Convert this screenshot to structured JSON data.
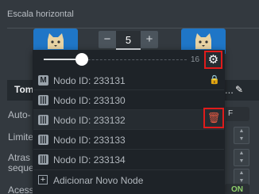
{
  "section": {
    "title": "Escala horizontal"
  },
  "stepper": {
    "minus": "−",
    "value": "5",
    "plus": "+"
  },
  "background": {
    "panel_label": "Tom",
    "dots": "...",
    "autoscale_label": "Auto-",
    "limit_label": "Limite",
    "delay_label_line1": "Atras",
    "delay_label_line2": "seque",
    "ssl_label": "Acesso via SLB",
    "toggle_off_label": "F",
    "toggle_on_label": "ON"
  },
  "dropdown": {
    "slider": {
      "max_label": "16",
      "value_fraction": 0.25
    },
    "nodes": [
      {
        "badge": "M",
        "label": "Nodo ID: 233131",
        "locked": true
      },
      {
        "badge": "|||",
        "label": "Nodo ID: 233130"
      },
      {
        "badge": "|||",
        "label": "Nodo ID: 233132",
        "highlighted": true
      },
      {
        "badge": "|||",
        "label": "Nodo ID: 233133"
      },
      {
        "badge": "|||",
        "label": "Nodo ID: 233134"
      }
    ],
    "add_node": {
      "icon": "+",
      "label": "Adicionar Novo Node"
    }
  },
  "icons": {
    "gear": "gear-icon",
    "trash": "trash-icon",
    "lock": "lock-icon",
    "pencil": "pencil-icon",
    "tomcat": "tomcat-icon"
  },
  "colors": {
    "background": "#33393f",
    "dropdown": "#1e2328",
    "highlight_border": "#e01b1b",
    "trash": "#ea5a42",
    "on_green": "#8ed06a",
    "tomcat_blue": "#1f76c7"
  }
}
